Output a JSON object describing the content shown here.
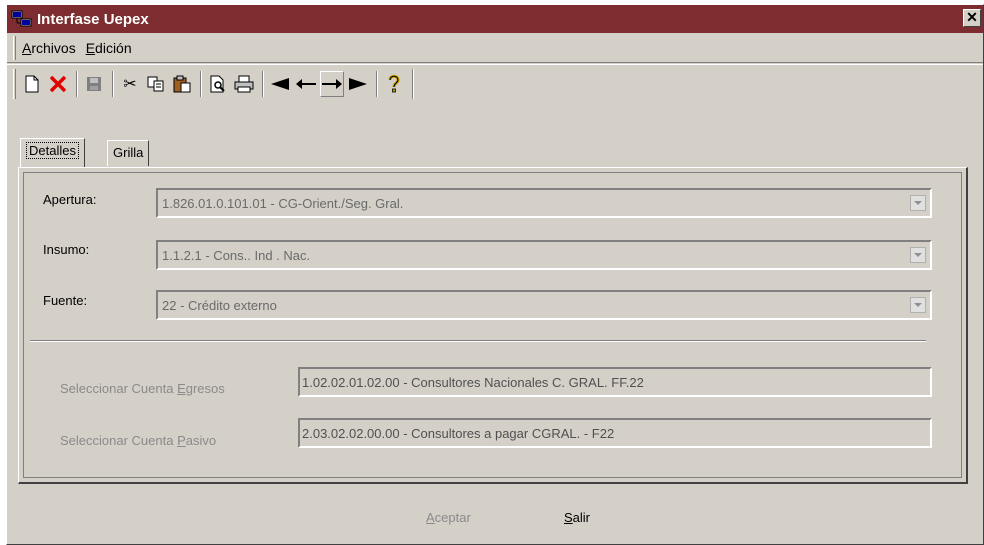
{
  "window": {
    "title": "Interfase Uepex"
  },
  "menu": [
    {
      "accel": "A",
      "rest": "rchivos"
    },
    {
      "accel": "E",
      "rest": "dición"
    }
  ],
  "toolbar": [
    "new-icon",
    "delete-icon",
    "save-icon",
    "cut-icon",
    "copy-icon",
    "paste-icon",
    "print-preview-icon",
    "print-icon",
    "first-record-icon",
    "previous-record-icon",
    "next-record-icon",
    "last-record-icon",
    "help-icon"
  ],
  "tabs": {
    "detalles": "Detalles",
    "grilla": "Grilla"
  },
  "form": {
    "apertura_label": "Apertura:",
    "apertura_value": "1.826.01.0.101.01 - CG-Orient./Seg. Gral.",
    "insumo_label": "Insumo:",
    "insumo_value": "1.1.2.1 - Cons.. Ind . Nac.",
    "fuente_label": "Fuente:",
    "fuente_value": "22 - Crédito externo",
    "egresos_label_pre": "Seleccionar Cuenta ",
    "egresos_label_accel": "E",
    "egresos_label_post": "gresos",
    "egresos_value": "1.02.02.01.02.00 - Consultores Nacionales C. GRAL. FF.22",
    "pasivo_label_pre": "Seleccionar Cuenta ",
    "pasivo_label_accel": "P",
    "pasivo_label_post": "asivo",
    "pasivo_value": "2.03.02.02.00.00 - Consultores a pagar CGRAL. - F22"
  },
  "buttons": {
    "aceptar_accel": "A",
    "aceptar_rest": "ceptar",
    "salir_accel": "S",
    "salir_rest": "alir"
  }
}
